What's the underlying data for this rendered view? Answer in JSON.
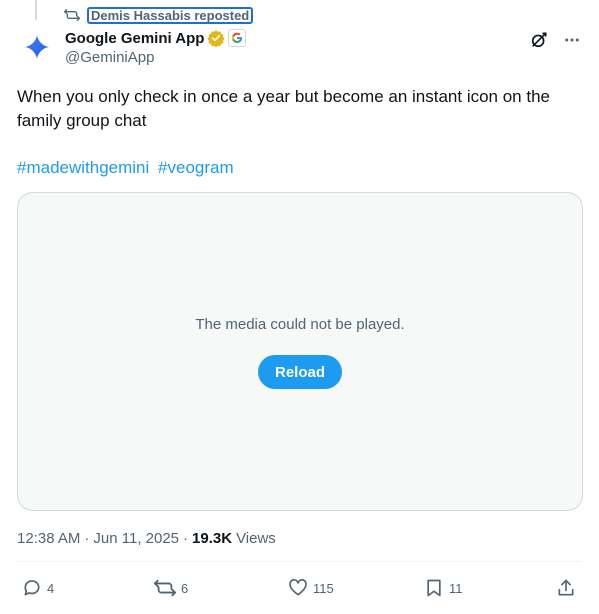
{
  "repost": {
    "label": "Demis Hassabis reposted",
    "icon": "repost-icon"
  },
  "author": {
    "display_name": "Google Gemini App",
    "handle": "@GeminiApp",
    "verified_badge": "gold-verified-icon",
    "affiliation": "G",
    "avatar_icon": "gemini-sparkle-icon"
  },
  "top_actions": {
    "grok_icon": "grok-icon",
    "more_icon": "more-icon"
  },
  "tweet": {
    "text": "When you only check in once a year but become an instant icon on the family group chat",
    "hashtags": [
      "#madewithgemini",
      "#veogram"
    ]
  },
  "media": {
    "error_message": "The media could not be played.",
    "reload_label": "Reload"
  },
  "meta": {
    "time": "12:38 AM",
    "separator": "·",
    "date": "Jun 11, 2025",
    "views_count": "19.3K",
    "views_label": "Views"
  },
  "engagement": {
    "replies": "4",
    "reposts": "6",
    "likes": "115",
    "bookmarks": "11"
  },
  "colors": {
    "accent": "#1d9bf0",
    "text_secondary": "#536471",
    "verified_gold": "#e2b719"
  }
}
